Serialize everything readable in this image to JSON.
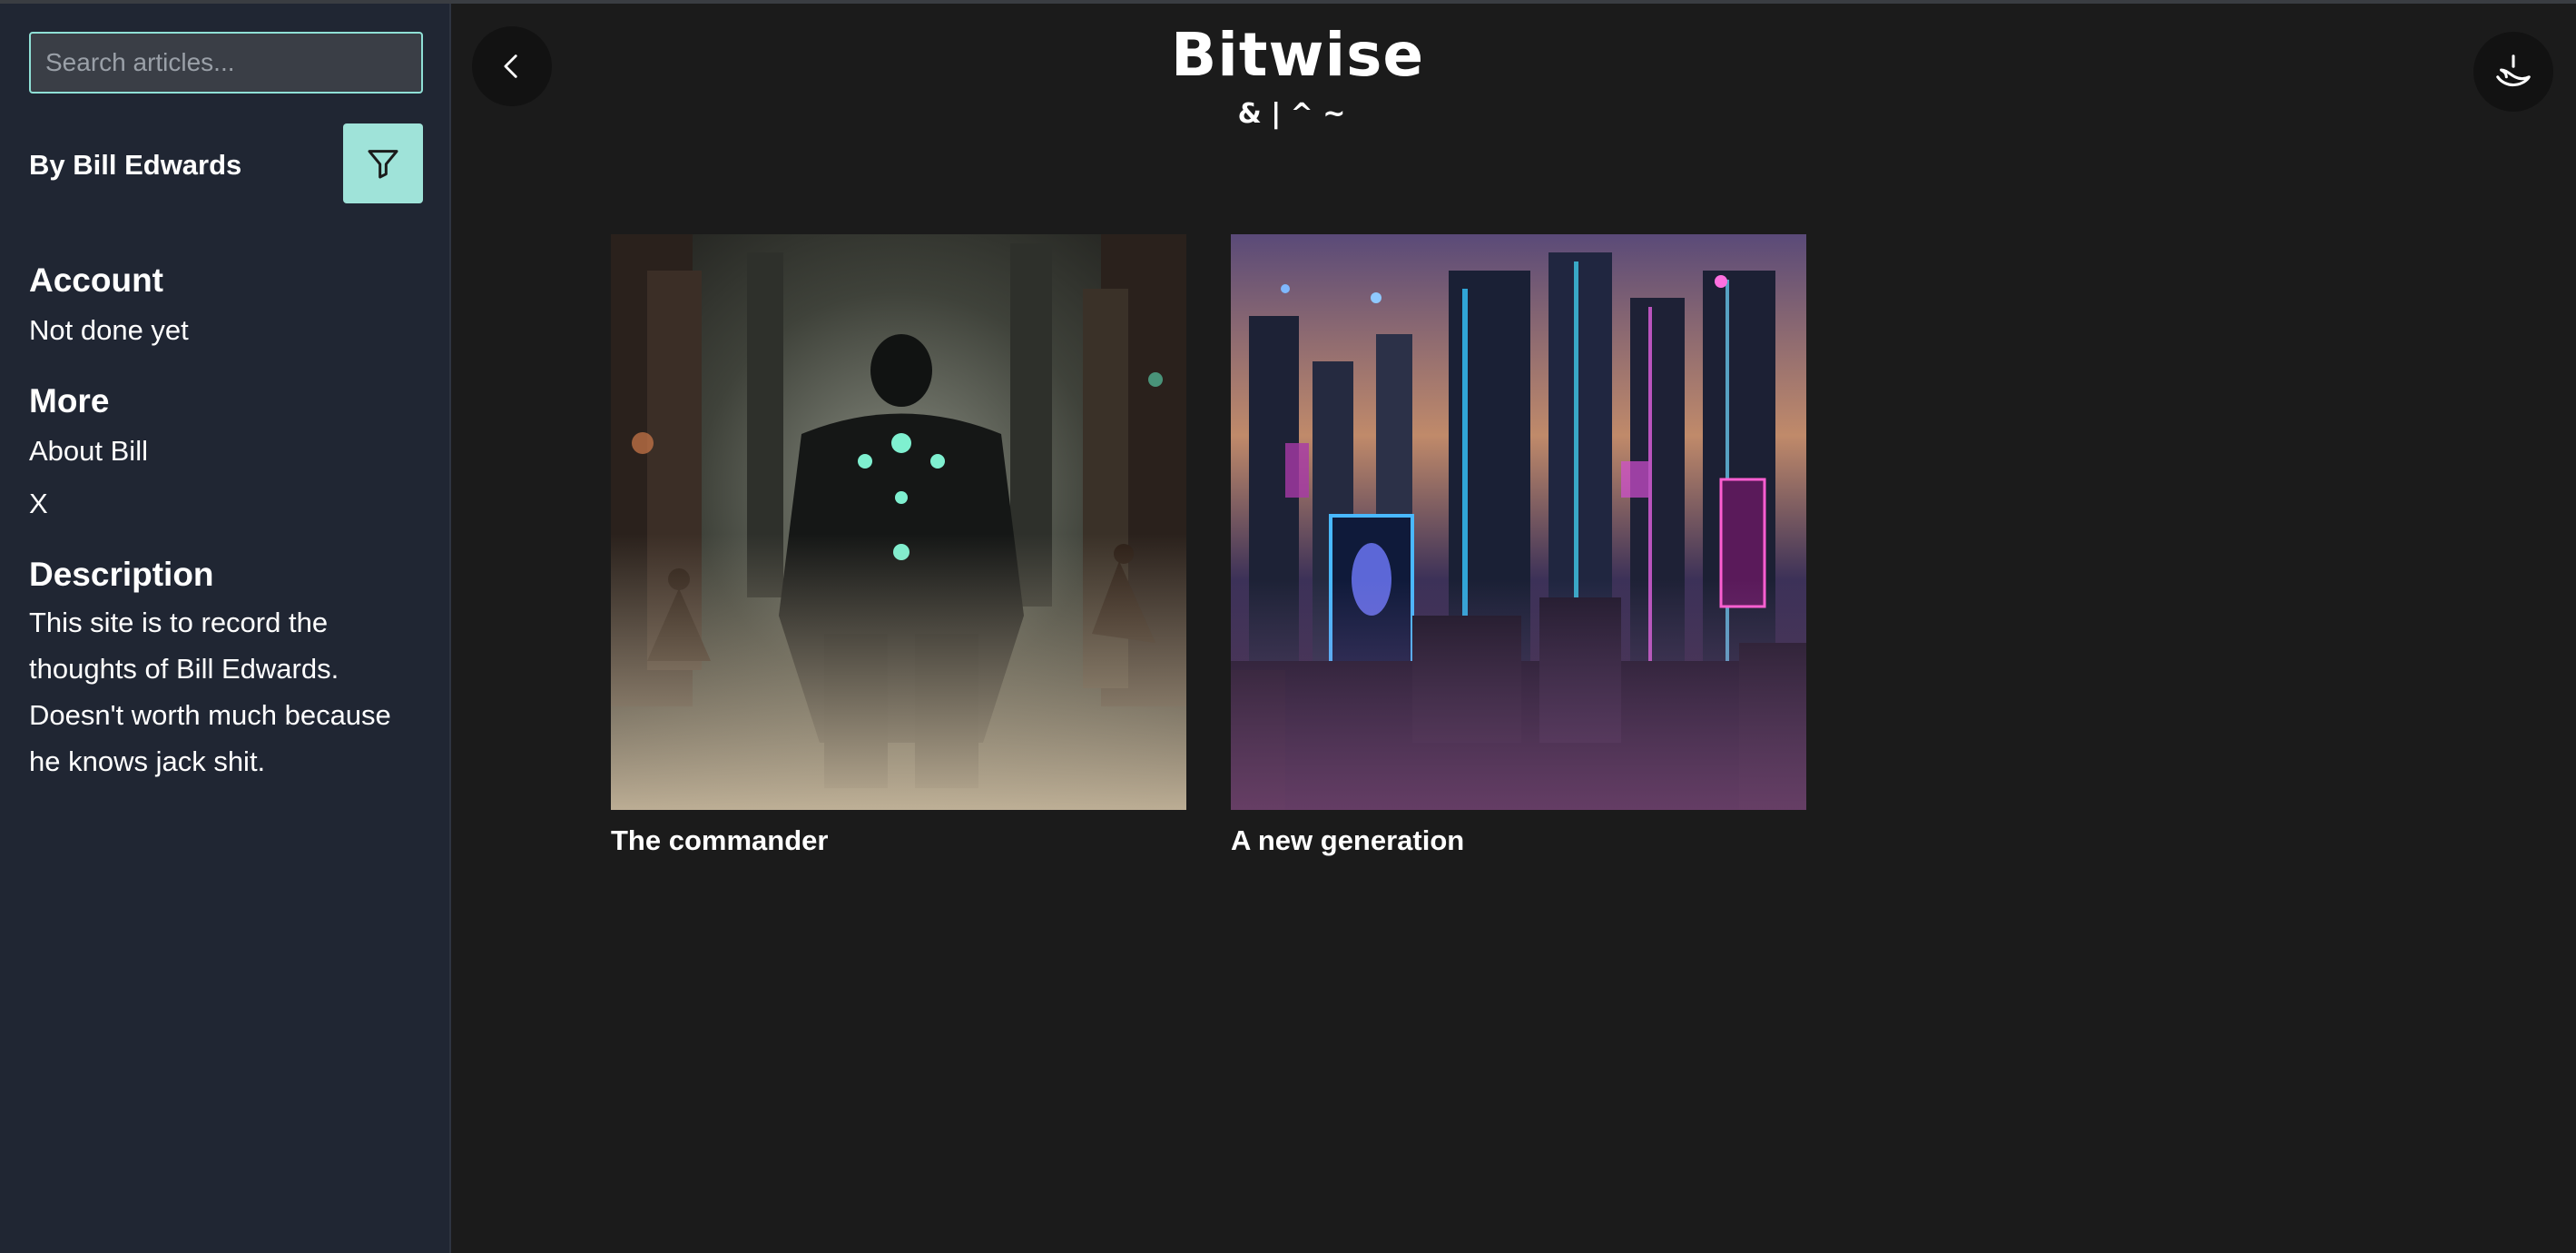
{
  "sidebar": {
    "search_placeholder": "Search articles...",
    "byline": "By Bill Edwards",
    "sections": {
      "account": {
        "title": "Account",
        "items": [
          "Not done yet"
        ]
      },
      "more": {
        "title": "More",
        "items": [
          "About Bill",
          "X"
        ]
      },
      "description": {
        "title": "Description",
        "text": "This site is to record the thoughts of Bill Edwards. Doesn't worth much because he knows jack shit."
      }
    }
  },
  "header": {
    "title": "Bitwise",
    "subtitle": "& | ^ ~"
  },
  "articles": [
    {
      "title": "The commander",
      "image": "cyberpunk-soldier-image"
    },
    {
      "title": "A new generation",
      "image": "neon-city-image"
    }
  ],
  "colors": {
    "page_bg": "#1b1b1b",
    "sidebar_bg": "#202633",
    "accent": "#9fe3d9"
  }
}
